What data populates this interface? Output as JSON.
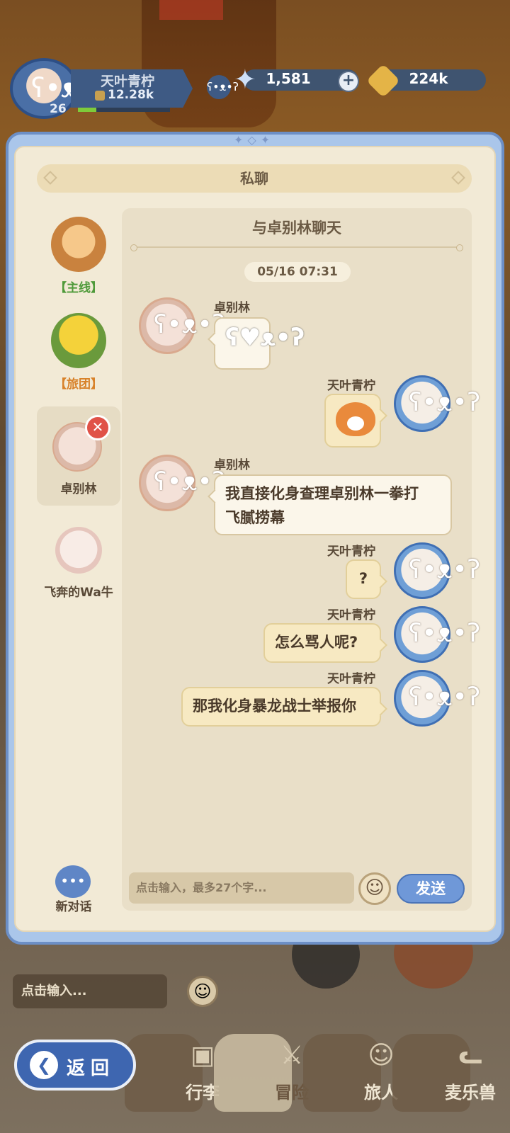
{
  "hud": {
    "player_name": "天叶青柠",
    "power": "12.28k",
    "level": "26",
    "gems": "1,581",
    "coins": "224k"
  },
  "panel": {
    "title": "私聊",
    "chat_with": "与卓别林聊天",
    "timestamp": "05/16  07:31"
  },
  "sidebar": {
    "items": [
      {
        "label": "【主线】",
        "color": "#4f9a3a"
      },
      {
        "label": "【旅团】",
        "color": "#d8822a"
      },
      {
        "label": "卓别林"
      },
      {
        "label": "飞奔的Wa牛"
      }
    ],
    "new_chat": "新对话",
    "close_icon": "✕"
  },
  "messages": [
    {
      "sender": "卓别林",
      "side": "left",
      "sticker": "bear-heart-sticker"
    },
    {
      "sender": "天叶青柠",
      "side": "right",
      "sticker": "fox-sticker"
    },
    {
      "sender": "卓别林",
      "side": "left",
      "text_line1": "我直接化身查理卓别林一拳打",
      "text_line2": "飞腻捞幕"
    },
    {
      "sender": "天叶青柠",
      "side": "right",
      "text": "?"
    },
    {
      "sender": "天叶青柠",
      "side": "right",
      "text": "怎么骂人呢?"
    },
    {
      "sender": "天叶青柠",
      "side": "right",
      "text": "那我化身暴龙战士举报你"
    }
  ],
  "input": {
    "placeholder": "点击输入，最多27个字...",
    "send_label": "发送"
  },
  "background": {
    "input_placeholder": "点击输入...",
    "back_label": "返回",
    "nav": [
      "行李",
      "冒险",
      "旅人",
      "麦乐兽"
    ]
  },
  "colors": {
    "panel_blue": "#aac6ea",
    "panel_cream": "#f2ead6",
    "send_blue": "#6f98d8",
    "close_red": "#e05248"
  }
}
